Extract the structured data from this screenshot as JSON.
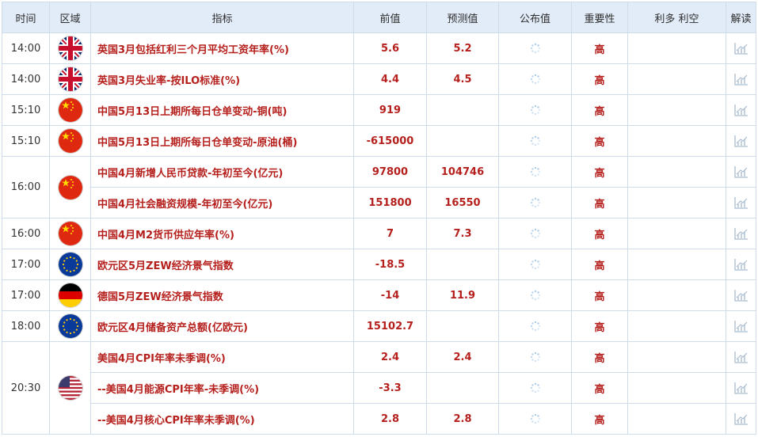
{
  "headers": {
    "time": "时间",
    "region": "区域",
    "indicator": "指标",
    "previous": "前值",
    "forecast": "预测值",
    "actual": "公布值",
    "importance": "重要性",
    "impact": "利多 利空",
    "analysis": "解读"
  },
  "colors": {
    "header_bg": "#e2ecf8",
    "border": "#cfdcea",
    "accent_red": "#b5201d",
    "icon_gray": "#a9bccf"
  },
  "rows": [
    {
      "time": "14:00",
      "flag": "uk-flag-icon",
      "indicator": "英国3月包括红利三个月平均工资年率(%)",
      "previous": "5.6",
      "forecast": "5.2",
      "importance": "高"
    },
    {
      "time": "14:00",
      "flag": "uk-flag-icon",
      "indicator": "英国3月失业率-按ILO标准(%)",
      "previous": "4.4",
      "forecast": "4.5",
      "importance": "高"
    },
    {
      "time": "15:10",
      "flag": "china-flag-icon",
      "indicator": "中国5月13日上期所每日仓单变动-铜(吨)",
      "previous": "919",
      "forecast": "",
      "importance": "高"
    },
    {
      "time": "15:10",
      "flag": "china-flag-icon",
      "indicator": "中国5月13日上期所每日仓单变动-原油(桶)",
      "previous": "-615000",
      "forecast": "",
      "importance": "高"
    },
    {
      "time": "16:00",
      "flag": "china-flag-icon",
      "indicator": "中国4月新增人民币贷款-年初至今(亿元)",
      "previous": "97800",
      "forecast": "104746",
      "importance": "高"
    },
    {
      "time": "",
      "flag": "",
      "indicator": "中国4月社会融资规模-年初至今(亿元)",
      "previous": "151800",
      "forecast": "16550",
      "importance": "高"
    },
    {
      "time": "16:00",
      "flag": "china-flag-icon",
      "indicator": "中国4月M2货币供应年率(%)",
      "previous": "7",
      "forecast": "7.3",
      "importance": "高"
    },
    {
      "time": "17:00",
      "flag": "eu-flag-icon",
      "indicator": "欧元区5月ZEW经济景气指数",
      "previous": "-18.5",
      "forecast": "",
      "importance": "高"
    },
    {
      "time": "17:00",
      "flag": "germany-flag-icon",
      "indicator": "德国5月ZEW经济景气指数",
      "previous": "-14",
      "forecast": "11.9",
      "importance": "高"
    },
    {
      "time": "18:00",
      "flag": "eu-flag-icon",
      "indicator": "欧元区4月储备资产总额(亿欧元)",
      "previous": "15102.7",
      "forecast": "",
      "importance": "高"
    },
    {
      "time": "20:30",
      "flag": "us-flag-icon",
      "indicator": "美国4月CPI年率未季调(%)",
      "previous": "2.4",
      "forecast": "2.4",
      "importance": "高"
    },
    {
      "time": "",
      "flag": "",
      "indicator": "--美国4月能源CPI年率-未季调(%)",
      "previous": "-3.3",
      "forecast": "",
      "importance": "高"
    },
    {
      "time": "",
      "flag": "",
      "indicator": "--美国4月核心CPI年率未季调(%)",
      "previous": "2.8",
      "forecast": "2.8",
      "importance": "高"
    }
  ]
}
